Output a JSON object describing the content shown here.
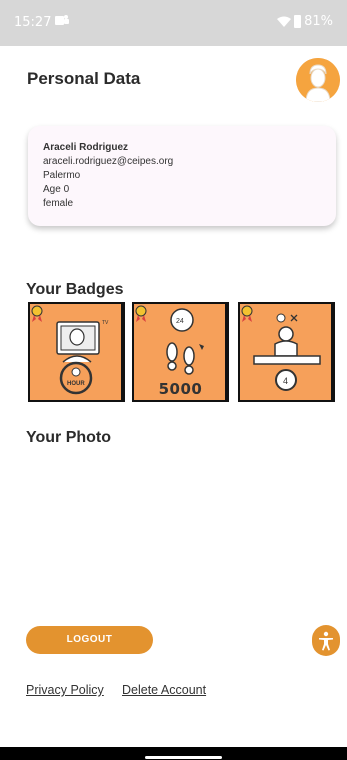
{
  "status_bar": {
    "time": "15:27",
    "battery": "81%"
  },
  "header": {
    "title": "Personal Data"
  },
  "profile": {
    "name": "Araceli Rodriguez",
    "email": "araceli.rodriguez@ceipes.org",
    "city": "Palermo",
    "age": "Age 0",
    "gender": "female"
  },
  "badges": {
    "title": "Your Badges",
    "items": [
      {
        "icon": "tv-hour-badge-icon",
        "label": "HOUR"
      },
      {
        "icon": "steps-badge-icon",
        "count": "5000"
      },
      {
        "icon": "sitting-person-badge-icon"
      }
    ]
  },
  "photo": {
    "title": "Your Photo"
  },
  "actions": {
    "logout_label": "LOGOUT"
  },
  "footer": {
    "privacy_label": "Privacy Policy",
    "delete_label": "Delete Account"
  },
  "colors": {
    "accent": "#e3932f",
    "badge_bg": "#f6a05a",
    "status_bar": "#d7d7d7"
  }
}
